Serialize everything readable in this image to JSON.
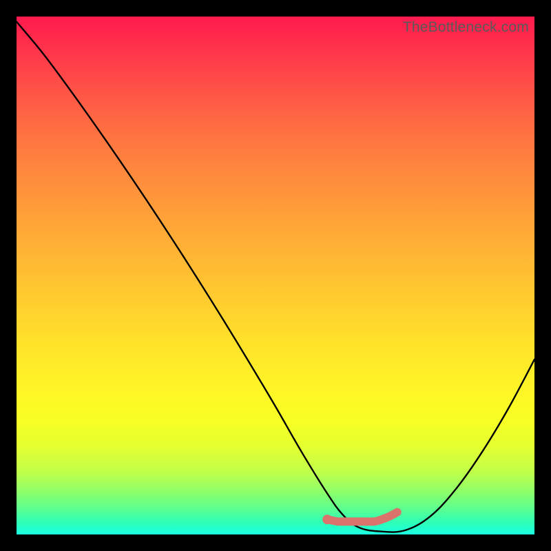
{
  "watermark": "TheBottleneck.com",
  "chart_data": {
    "type": "line",
    "title": "",
    "xlabel": "",
    "ylabel": "",
    "xlim": [
      0,
      100
    ],
    "ylim": [
      0,
      100
    ],
    "grid": false,
    "gradient_background": {
      "top": "#ff1a4e",
      "middle": "#ffe42a",
      "bottom": "#1cffe2"
    },
    "series": [
      {
        "name": "bottleneck-curve",
        "color": "#000000",
        "x": [
          0,
          5,
          10,
          15,
          20,
          25,
          30,
          35,
          40,
          45,
          50,
          55,
          60,
          63,
          66,
          70,
          75,
          80,
          85,
          90,
          95,
          100
        ],
        "values": [
          99,
          93,
          86.3,
          79.3,
          72.1,
          64.7,
          57.1,
          49.3,
          41.3,
          33.1,
          24.7,
          16,
          7.9,
          3.8,
          1.4,
          0.6,
          0.8,
          3.6,
          9.0,
          16.1,
          24.4,
          33.8
        ]
      },
      {
        "name": "optimal-segment",
        "color": "#e57373",
        "style": "rounded",
        "x": [
          60.0,
          61.0,
          62.0,
          63.0,
          65.0,
          67.0,
          69.0,
          70.5,
          72.0,
          73.5
        ],
        "values": [
          2.9,
          2.7,
          2.5,
          2.5,
          2.5,
          2.5,
          2.5,
          2.9,
          3.5,
          4.3
        ]
      }
    ],
    "marker": {
      "name": "optimal-start-point",
      "color": "#e57373",
      "x": 60.0,
      "y": 2.9
    }
  }
}
